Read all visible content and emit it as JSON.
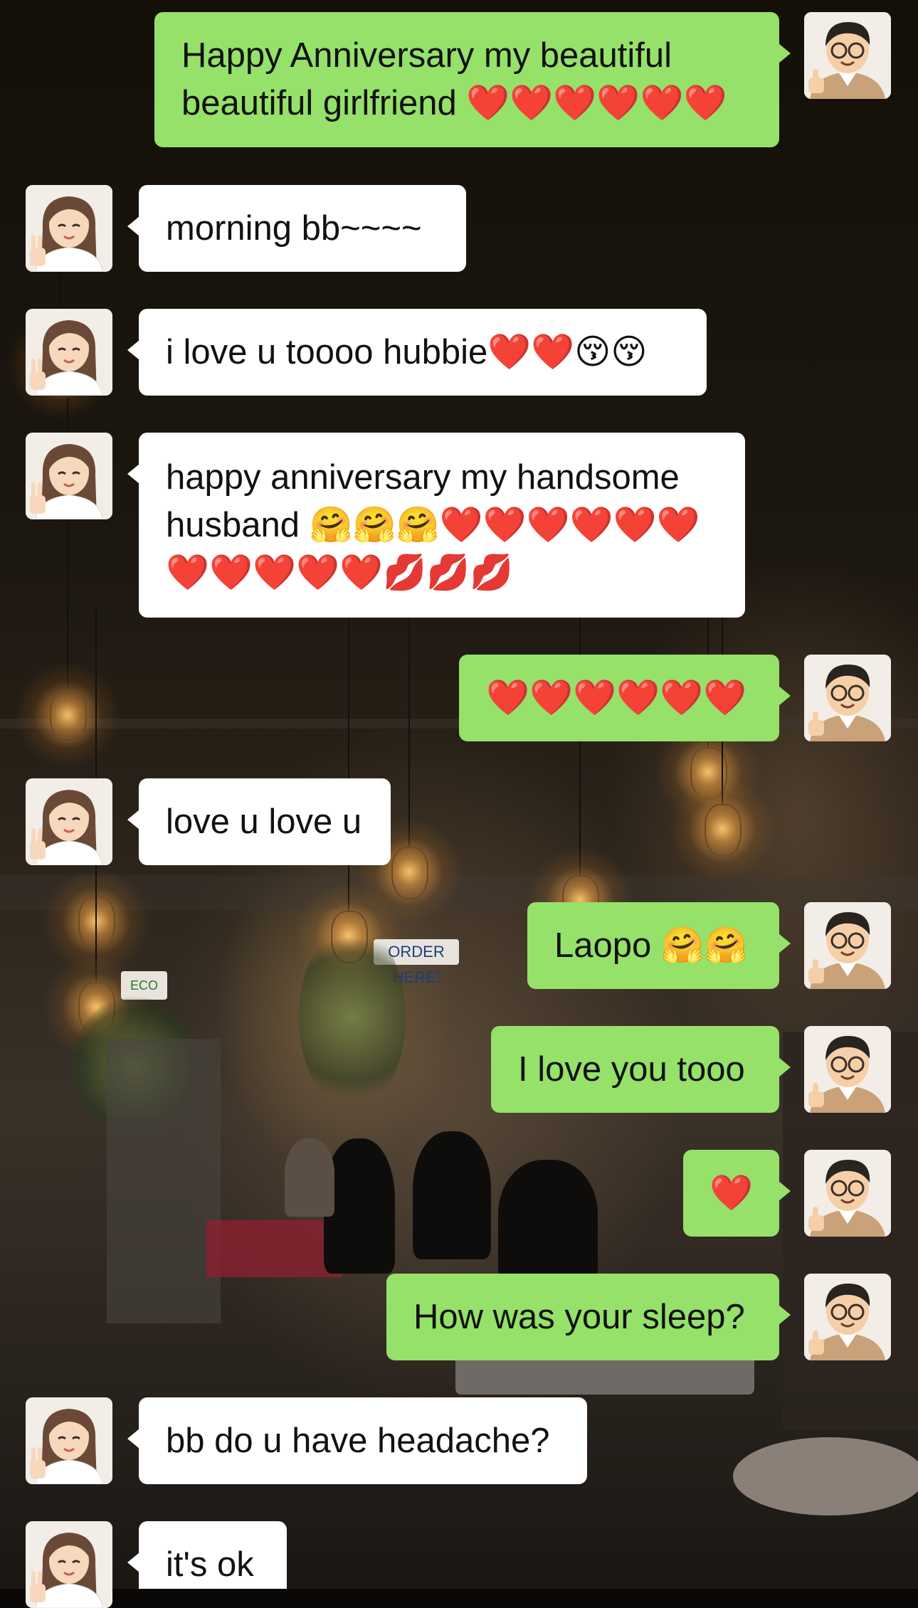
{
  "contacts": {
    "me": {
      "avatar_icon": "man-with-glasses-thumbs-up-avatar-icon"
    },
    "her": {
      "avatar_icon": "woman-peace-sign-avatar-icon"
    }
  },
  "background": {
    "sign_text": "ORDER HERE!",
    "box_label": "ECO"
  },
  "messages": [
    {
      "sender": "me",
      "text": "Happy Anniversary my beautiful beautiful girlfriend ❤️❤️❤️❤️❤️❤️"
    },
    {
      "sender": "her",
      "text": "morning bb~~~~"
    },
    {
      "sender": "her",
      "text": "i love u toooo hubbie❤️❤️😚😚"
    },
    {
      "sender": "her",
      "text": "happy anniversary my handsome husband 🤗🤗🤗❤️❤️❤️❤️❤️❤️❤️❤️❤️❤️❤️💋💋💋"
    },
    {
      "sender": "me",
      "text": "❤️❤️❤️❤️❤️❤️"
    },
    {
      "sender": "her",
      "text": "love u love u"
    },
    {
      "sender": "me",
      "text": "Laopo 🤗🤗"
    },
    {
      "sender": "me",
      "text": "I love you tooo"
    },
    {
      "sender": "me",
      "text": "❤️"
    },
    {
      "sender": "me",
      "text": "How was your sleep?"
    },
    {
      "sender": "her",
      "text": "bb do u have headache?"
    },
    {
      "sender": "her",
      "text": "it's ok"
    }
  ],
  "colors": {
    "outgoing_bubble": "#95e16a",
    "incoming_bubble": "#ffffff"
  }
}
